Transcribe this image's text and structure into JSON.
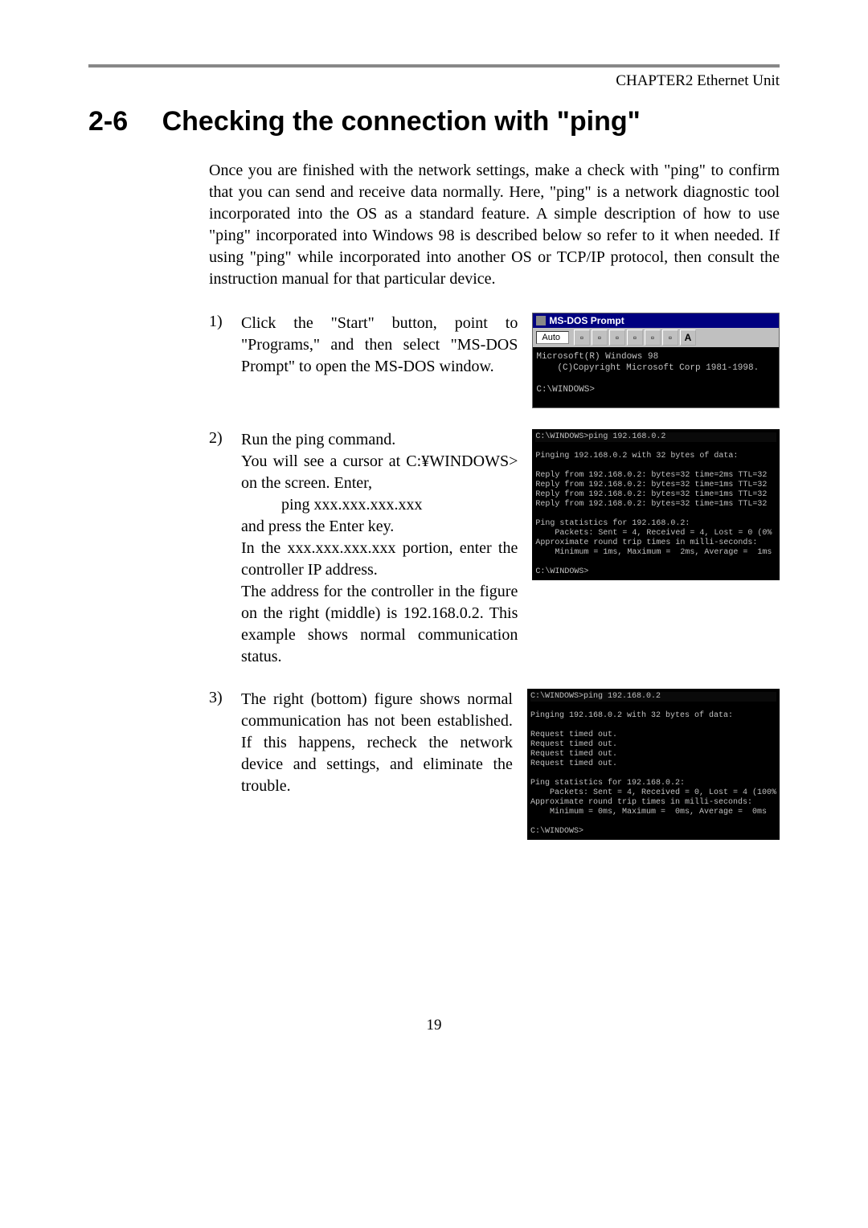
{
  "header": {
    "chapter": "CHAPTER2  Ethernet Unit"
  },
  "section": {
    "number": "2-6",
    "title": "Checking the connection with \"ping\""
  },
  "intro": "Once you are finished with the network settings, make a check with \"ping\" to confirm that you can send and receive data normally. Here, \"ping\" is a network diagnostic tool incorporated into the OS as a standard feature. A simple description of how to use \"ping\" incorporated into Windows 98 is described below so refer to it when needed. If using \"ping\" while incorporated into another OS or TCP/IP protocol, then consult the instruction manual for that particular device.",
  "steps": [
    {
      "num": "1)",
      "text": "Click the \"Start\" button, point to \"Programs,\" and then select \"MS-DOS Prompt\" to open the MS-DOS window."
    },
    {
      "num": "2)",
      "lines": {
        "a": "Run the ping command.",
        "b": "You will see a cursor at C:¥WINDOWS> on the screen. Enter,",
        "c": "ping xxx.xxx.xxx.xxx",
        "d": "and press the Enter key.",
        "e": "In the xxx.xxx.xxx.xxx portion, enter the controller IP address.",
        "f": "The address for the controller in the figure on the right (middle) is 192.168.0.2. This example shows normal communication status."
      }
    },
    {
      "num": "3)",
      "text": "The right (bottom) figure shows normal communication has not been established. If this happens, recheck the network device and settings, and eliminate the trouble."
    }
  ],
  "dos1": {
    "title": "MS-DOS Prompt",
    "toolbar": {
      "sel": "Auto",
      "btnA": "A"
    },
    "l1": "Microsoft(R) Windows 98",
    "l2": "(C)Copyright Microsoft Corp 1981-1998.",
    "l3": "C:\\WINDOWS>"
  },
  "term2": {
    "l1": "C:\\WINDOWS>ping 192.168.0.2",
    "l2": "Pinging 192.168.0.2 with 32 bytes of data:",
    "l3": "Reply from 192.168.0.2: bytes=32 time=2ms TTL=32",
    "l4": "Reply from 192.168.0.2: bytes=32 time=1ms TTL=32",
    "l5": "Reply from 192.168.0.2: bytes=32 time=1ms TTL=32",
    "l6": "Reply from 192.168.0.2: bytes=32 time=1ms TTL=32",
    "l7": "Ping statistics for 192.168.0.2:",
    "l8": "    Packets: Sent = 4, Received = 4, Lost = 0 (0%",
    "l9": "Approximate round trip times in milli-seconds:",
    "l10": "    Minimum = 1ms, Maximum =  2ms, Average =  1ms",
    "l11": "C:\\WINDOWS>"
  },
  "term3": {
    "l1": "C:\\WINDOWS>ping 192.168.0.2",
    "l2": "Pinging 192.168.0.2 with 32 bytes of data:",
    "l3": "Request timed out.",
    "l4": "Request timed out.",
    "l5": "Request timed out.",
    "l6": "Request timed out.",
    "l7": "Ping statistics for 192.168.0.2:",
    "l8": "    Packets: Sent = 4, Received = 0, Lost = 4 (100%",
    "l9": "Approximate round trip times in milli-seconds:",
    "l10": "    Minimum = 0ms, Maximum =  0ms, Average =  0ms",
    "l11": "C:\\WINDOWS>"
  },
  "page_number": "19"
}
